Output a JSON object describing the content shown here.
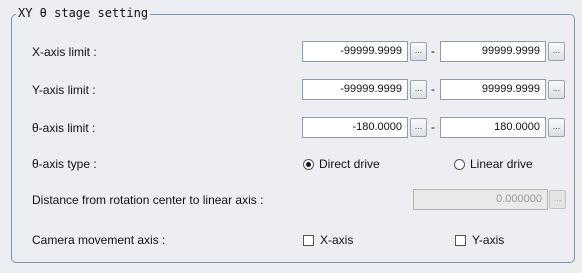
{
  "group_title": "XY θ  stage setting",
  "rows": {
    "x_axis": {
      "label": "X-axis limit :",
      "min": "-99999.9999",
      "max": "99999.9999"
    },
    "y_axis": {
      "label": "Y-axis limit :",
      "min": "-99999.9999",
      "max": "99999.9999"
    },
    "theta_axis": {
      "label": "θ-axis limit :",
      "min": "-180.0000",
      "max": "180.0000"
    }
  },
  "browse_label": "...",
  "range_separator": "-",
  "theta_type": {
    "label": "θ-axis type :",
    "options": [
      "Direct drive",
      "Linear drive"
    ],
    "selected": "Direct drive"
  },
  "distance": {
    "label": "Distance from rotation center to linear axis :",
    "value": "0.000000"
  },
  "camera": {
    "label": "Camera movement axis :",
    "x_label": "X-axis",
    "y_label": "Y-axis",
    "x_checked": false,
    "y_checked": false
  }
}
